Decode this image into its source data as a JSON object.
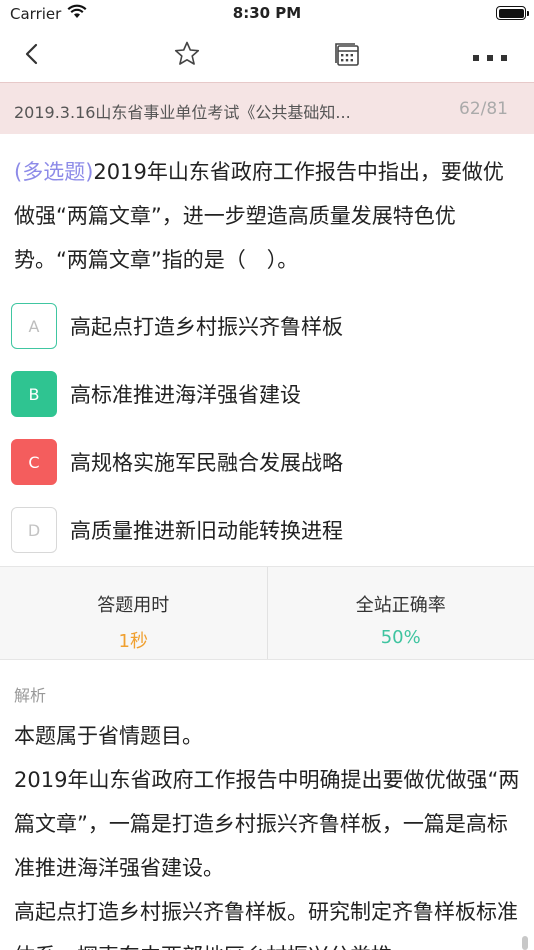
{
  "status_bar": {
    "carrier": "Carrier",
    "time": "8:30 PM"
  },
  "nav": {
    "icons": [
      "back-chevron-icon",
      "star-icon",
      "calendar-icon",
      "more-dots-icon"
    ]
  },
  "exam": {
    "title": "2019.3.16山东省事业单位考试《公共基础知...",
    "progress": "62/81"
  },
  "question": {
    "type_label": "(多选题)",
    "text": "2019年山东省政府工作报告中指出，要做优做强“两篇文章”，进一步塑造高质量发展特色优势。“两篇文章”指的是（　）。"
  },
  "options": [
    {
      "letter": "A",
      "text": "高起点打造乡村振兴齐鲁样板"
    },
    {
      "letter": "B",
      "text": "高标准推进海洋强省建设"
    },
    {
      "letter": "C",
      "text": "高规格实施军民融合发展战略"
    },
    {
      "letter": "D",
      "text": "高质量推进新旧动能转换进程"
    }
  ],
  "stats": {
    "time_label": "答题用时",
    "time_value": "1秒",
    "rate_label": "全站正确率",
    "rate_value": "50%"
  },
  "colors": {
    "accent_purple": "#8d8be8",
    "correct_green": "#2fc491",
    "wrong_red": "#f45d5d",
    "time_orange": "#f0a030",
    "rate_teal": "#3fc4a0",
    "title_bar_bg": "#f5e4e4"
  },
  "analysis": {
    "label": "解析",
    "paragraphs": [
      "本题属于省情题目。",
      "2019年山东省政府工作报告中明确提出要做优做强“两篇文章”，一篇是打造乡村振兴齐鲁样板，一篇是高标准推进海洋强省建设。",
      "高起点打造乡村振兴齐鲁样板。研究制定齐鲁样板标准体系，探索东中西部地区乡村振兴分类推"
    ]
  }
}
